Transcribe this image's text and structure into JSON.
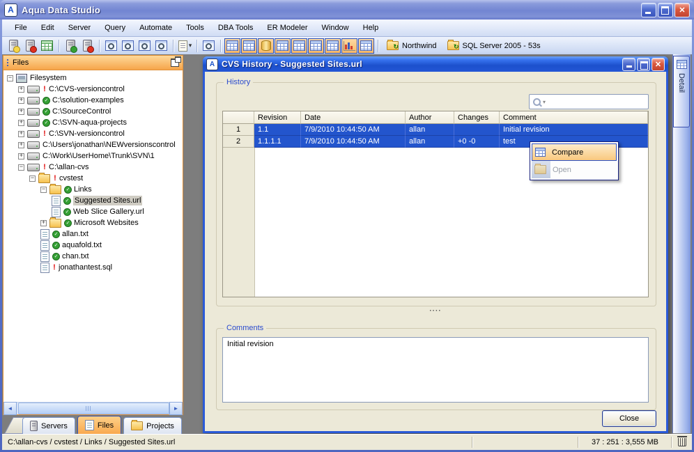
{
  "window": {
    "title": "Aqua Data Studio",
    "controls": [
      "minimize",
      "maximize",
      "close"
    ]
  },
  "menubar": {
    "items": [
      "File",
      "Edit",
      "Server",
      "Query",
      "Automate",
      "Tools",
      "DBA Tools",
      "ER Modeler",
      "Window",
      "Help"
    ]
  },
  "toolbar": {
    "icons": [
      "register-server",
      "remove-server",
      "table-data",
      "connect-server",
      "disconnect-server",
      "query-analyzer",
      "query-browser",
      "query-window",
      "edit-results",
      "open-script",
      "schema-browser"
    ],
    "view_toggles": [
      "grid-view",
      "details-view",
      "database-view",
      "table-view",
      "schedule-view",
      "list-view",
      "er-diagram-view",
      "chart-view",
      "results-view"
    ],
    "connections": [
      {
        "label": "Northwind",
        "icon": "folder-sync-icon"
      },
      {
        "label": "SQL Server 2005 - 53s",
        "icon": "folder-sync-icon"
      }
    ]
  },
  "files_panel": {
    "title": "Files",
    "tree": [
      {
        "label": "Filesystem",
        "level": 0,
        "expander": "minus",
        "icon": "computer",
        "badge": "none",
        "selected": false
      },
      {
        "label": "C:\\CVS-versioncontrol",
        "level": 1,
        "expander": "plus",
        "icon": "drive",
        "badge": "error",
        "selected": false
      },
      {
        "label": "C:\\solution-examples",
        "level": 1,
        "expander": "plus",
        "icon": "drive",
        "badge": "ok",
        "selected": false
      },
      {
        "label": "C:\\SourceControl",
        "level": 1,
        "expander": "plus",
        "icon": "drive",
        "badge": "ok",
        "selected": false
      },
      {
        "label": "C:\\SVN-aqua-projects",
        "level": 1,
        "expander": "plus",
        "icon": "drive",
        "badge": "ok",
        "selected": false
      },
      {
        "label": "C:\\SVN-versioncontrol",
        "level": 1,
        "expander": "plus",
        "icon": "drive",
        "badge": "error",
        "selected": false
      },
      {
        "label": "C:\\Users\\jonathan\\NEWversionscontrol",
        "level": 1,
        "expander": "plus",
        "icon": "drive",
        "badge": "none",
        "selected": false
      },
      {
        "label": "C:\\Work\\UserHome\\Trunk\\SVN\\1",
        "level": 1,
        "expander": "plus",
        "icon": "drive",
        "badge": "none",
        "selected": false
      },
      {
        "label": "C:\\allan-cvs",
        "level": 1,
        "expander": "minus",
        "icon": "drive",
        "badge": "error",
        "selected": false
      },
      {
        "label": "cvstest",
        "level": 2,
        "expander": "minus",
        "icon": "folder",
        "badge": "error",
        "selected": false
      },
      {
        "label": "Links",
        "level": 3,
        "expander": "minus",
        "icon": "folder",
        "badge": "ok",
        "selected": false
      },
      {
        "label": "Suggested Sites.url",
        "level": 4,
        "expander": "none",
        "icon": "file",
        "badge": "ok",
        "selected": true
      },
      {
        "label": "Web Slice Gallery.url",
        "level": 4,
        "expander": "none",
        "icon": "file",
        "badge": "ok",
        "selected": false
      },
      {
        "label": "Microsoft Websites",
        "level": 3,
        "expander": "plus",
        "icon": "folder",
        "badge": "ok",
        "selected": false
      },
      {
        "label": "allan.txt",
        "level": 3,
        "expander": "none",
        "icon": "file",
        "badge": "ok",
        "selected": false
      },
      {
        "label": "aquafold.txt",
        "level": 3,
        "expander": "none",
        "icon": "file",
        "badge": "ok",
        "selected": false
      },
      {
        "label": "chan.txt",
        "level": 3,
        "expander": "none",
        "icon": "file",
        "badge": "ok",
        "selected": false
      },
      {
        "label": "jonathantest.sql",
        "level": 3,
        "expander": "none",
        "icon": "file",
        "badge": "error",
        "selected": false
      }
    ],
    "tabs": [
      {
        "label": "Servers",
        "active": false,
        "icon": "server-icon"
      },
      {
        "label": "Files",
        "active": true,
        "icon": "file-icon"
      },
      {
        "label": "Projects",
        "active": false,
        "icon": "folder-icon"
      }
    ]
  },
  "dialog": {
    "title": "CVS History - Suggested Sites.url",
    "controls": [
      "minimize",
      "maximize",
      "close"
    ],
    "history": {
      "legend": "History",
      "search_value": "",
      "table": {
        "columns": [
          "",
          "Revision",
          "Date",
          "Author",
          "Changes",
          "Comment"
        ],
        "rows": [
          {
            "num": "1",
            "revision": "1.1",
            "date": "7/9/2010 10:44:50 AM",
            "author": "allan",
            "changes": "",
            "comment": "Initial revision",
            "selected": true
          },
          {
            "num": "2",
            "revision": "1.1.1.1",
            "date": "7/9/2010 10:44:50 AM",
            "author": "allan",
            "changes": "+0 -0",
            "comment": "test",
            "selected": true
          }
        ]
      }
    },
    "context_menu": {
      "items": [
        {
          "label": "Compare",
          "enabled": true,
          "highlighted": true,
          "icon": "compare-icon"
        },
        {
          "label": "Open",
          "enabled": false,
          "highlighted": false,
          "icon": "open-folder-icon"
        }
      ]
    },
    "comments": {
      "legend": "Comments",
      "text": "Initial revision"
    },
    "close_label": "Close"
  },
  "detail_tab": {
    "label": "Detail",
    "icon": "table-icon"
  },
  "statusbar": {
    "path": "C:\\allan-cvs / cvstest / Links / Suggested Sites.url",
    "memory": "37 : 251 : 3,555 MB",
    "trash_icon": "garbage-collect-icon"
  },
  "colors": {
    "selection_blue": "#2355cd",
    "panel_header_orange": "#f6a54a",
    "dialog_title_blue": "#1c50cc",
    "menu_highlight_orange": "#f9c87e",
    "workspace_gray": "#7d7d7d",
    "dialog_beige": "#ece9d8"
  }
}
